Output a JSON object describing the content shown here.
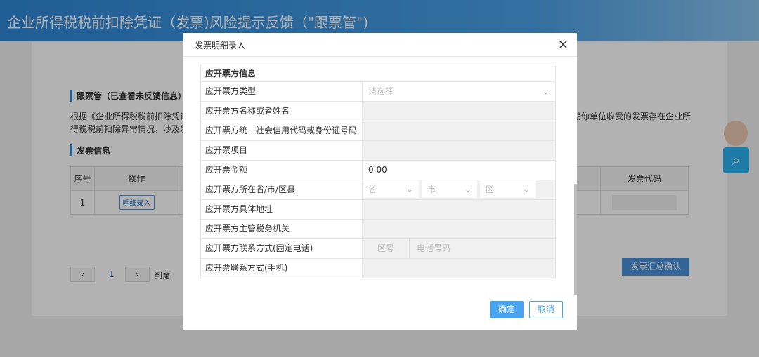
{
  "header": {
    "title": "企业所得税税前扣除凭证（发票)风险提示反馈（\"跟票管\")"
  },
  "page": {
    "section1": "跟票管（已查看未反馈信息）",
    "para_line1": "根据《企业所得税税前扣除凭证管",
    "para_line1_right": "期你单位收受的发票存在企业所",
    "para_line2": "得税税前扣除异常情况，涉及发票",
    "section2": "发票信息",
    "table": {
      "headers": [
        "序号",
        "操作",
        "发票代码"
      ],
      "row": {
        "index": "1",
        "action": "明细录入"
      }
    },
    "pagination": {
      "prev": "‹",
      "page": "1",
      "next": "›",
      "goto": "到第"
    },
    "summary_button": "发票汇总确认"
  },
  "modal": {
    "title": "发票明细录入",
    "close": "×",
    "section": "应开票方信息",
    "fields": [
      {
        "label": "应开票方类型",
        "placeholder": "请选择"
      },
      {
        "label": "应开票方名称或者姓名"
      },
      {
        "label": "应开票方统一社会信用代码或身份证号码"
      },
      {
        "label": "应开票项目"
      },
      {
        "label": "应开票金额",
        "value": "0.00"
      },
      {
        "label": "应开票方所在省/市/区县",
        "selects": [
          "省",
          "市",
          "区"
        ]
      },
      {
        "label": "应开票方具体地址"
      },
      {
        "label": "应开票方主管税务机关"
      },
      {
        "label": "应开票方联系方式(固定电话)",
        "area_code": "区号",
        "phone": "电话号码"
      },
      {
        "label": "应开票联系方式(手机)"
      }
    ],
    "confirm": "确定",
    "cancel": "取消"
  },
  "colors": {
    "accent": "#4aa3f0",
    "header": "#2e86d6"
  }
}
